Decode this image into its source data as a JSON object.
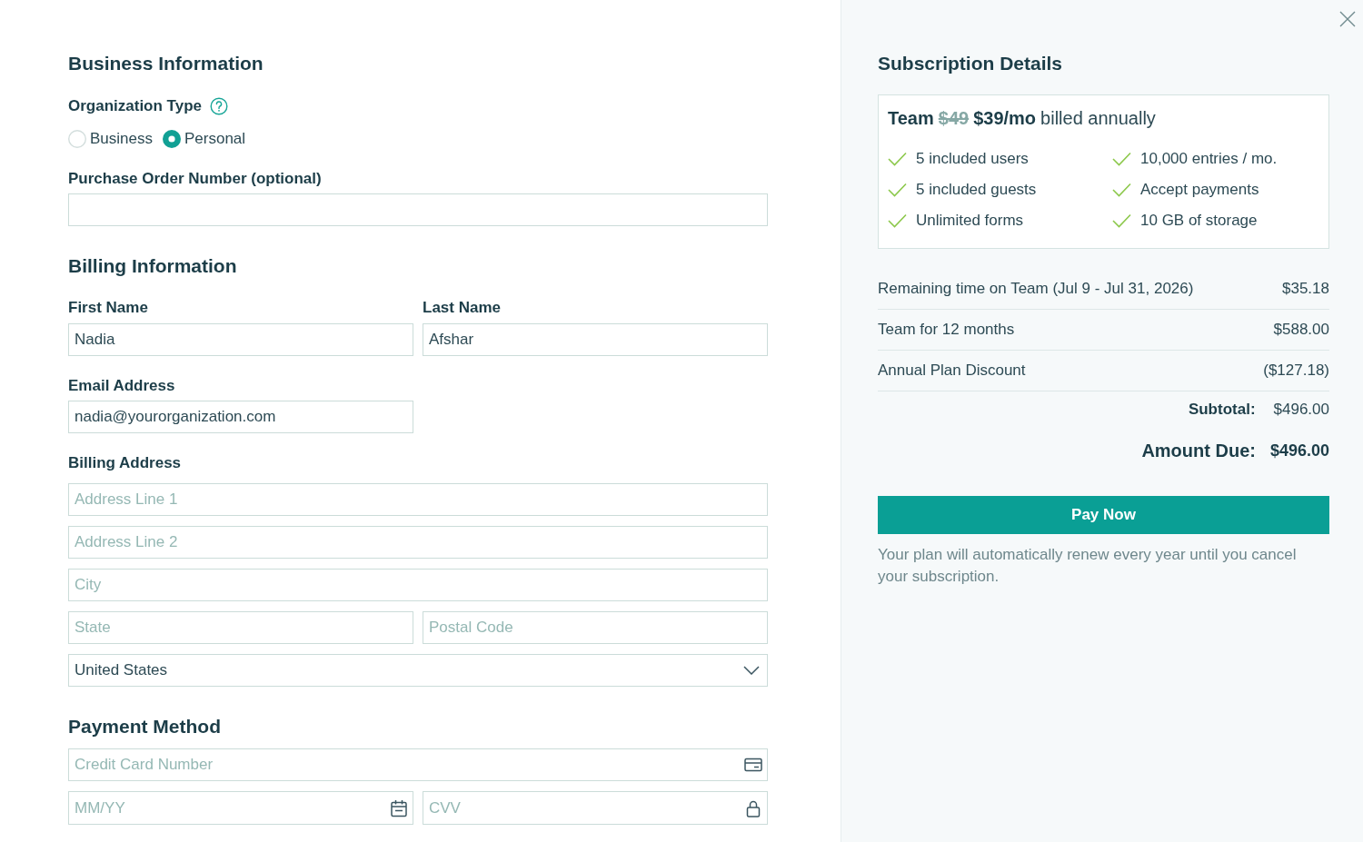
{
  "business_information": {
    "heading": "Business Information",
    "organization_type": {
      "label": "Organization Type",
      "options": [
        {
          "label": "Business",
          "selected": false
        },
        {
          "label": "Personal",
          "selected": true
        }
      ]
    },
    "purchase_order": {
      "label": "Purchase Order Number (optional)"
    }
  },
  "billing_information": {
    "heading": "Billing Information",
    "first_name": {
      "label": "First Name",
      "value": "Nadia"
    },
    "last_name": {
      "label": "Last Name",
      "value": "Afshar"
    },
    "email": {
      "label": "Email Address",
      "value": "nadia@yourorganization.com"
    },
    "billing_address": {
      "label": "Billing Address",
      "address_line_1": {
        "placeholder": "Address Line 1"
      },
      "address_line_2": {
        "placeholder": "Address Line 2"
      },
      "city": {
        "placeholder": "City"
      },
      "state": {
        "placeholder": "State"
      },
      "postal_code": {
        "placeholder": "Postal Code"
      },
      "country": {
        "value": "United States"
      }
    }
  },
  "payment_method": {
    "heading": "Payment Method",
    "card_number": {
      "placeholder": "Credit Card Number"
    },
    "expiry": {
      "placeholder": "MM/YY"
    },
    "cvv": {
      "placeholder": "CVV"
    }
  },
  "subscription": {
    "heading": "Subscription Details",
    "plan": {
      "name": "Team",
      "old_price": "$49",
      "price": "$39/mo",
      "billing": "billed annually",
      "features": [
        "5 included users",
        "10,000 entries / mo.",
        "5 included guests",
        "Accept payments",
        "Unlimited forms",
        "10 GB of storage"
      ]
    },
    "line_items": [
      {
        "label": "Remaining time on Team (Jul 9 - Jul 31, 2026)",
        "amount": "$35.18"
      },
      {
        "label": "Team for 12 months",
        "amount": "$588.00"
      },
      {
        "label": "Annual Plan Discount",
        "amount": "($127.18)"
      }
    ],
    "subtotal": {
      "label": "Subtotal:",
      "amount": "$496.00"
    },
    "amount_due": {
      "label": "Amount Due:",
      "amount": "$496.00"
    },
    "pay_button": "Pay Now",
    "renewal_note": "Your plan will automatically renew every year until you cancel your subscription."
  }
}
